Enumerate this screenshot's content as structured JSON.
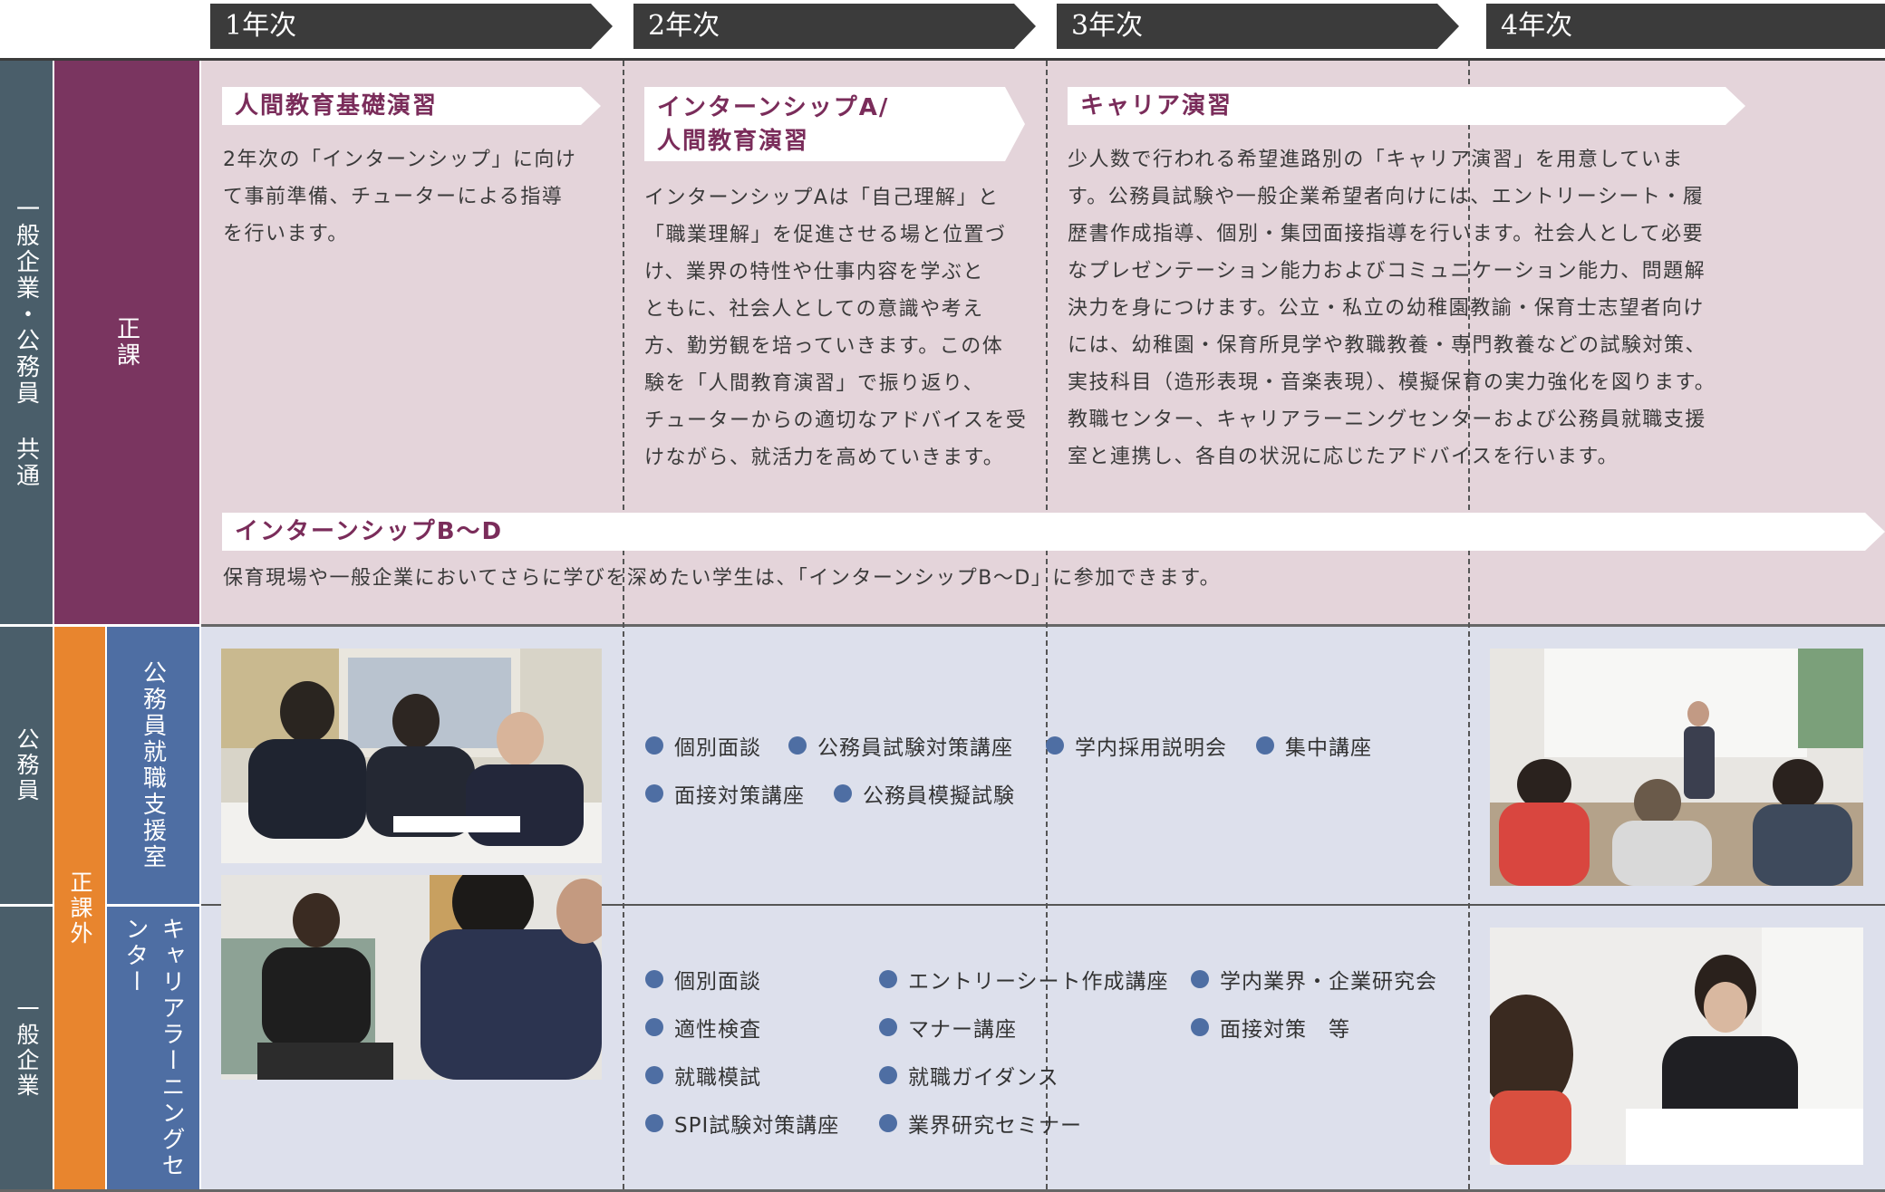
{
  "years": [
    "1年次",
    "2年次",
    "3年次",
    "4年次"
  ],
  "categories": {
    "common": "一般企業・公務員 共通",
    "regular": "正課",
    "civil_servant": "公務員",
    "extracurricular": "正課外",
    "civil_support_office": "公務員就職支援室",
    "general_company": "一般企業",
    "career_center": "キャリアラーニングセンター"
  },
  "regular": {
    "seminar1": {
      "title": "人間教育基礎演習",
      "text": "2年次の「インターンシップ」に向け\nて事前準備、チューターによる指導\nを行います。"
    },
    "seminar2": {
      "title_line1": "インターンシップA/",
      "title_line2": "人間教育演習",
      "text": "インターンシップAは「自己理解」と\n「職業理解」を促進させる場と位置づ\nけ、業界の特性や仕事内容を学ぶと\nともに、社会人としての意識や考え\n方、勤労観を培っていきます。この体\n験を「人間教育演習」で振り返り、\nチューターからの適切なアドバイスを受\nけながら、就活力を高めていきます。"
    },
    "career": {
      "title": "キャリア演習",
      "text": "少人数で行われる希望進路別の「キャリア演習」を用意していま\nす。公務員試験や一般企業希望者向けには、エントリーシート・履\n歴書作成指導、個別・集団面接指導を行います。社会人として必要\nなプレゼンテーション能力およびコミュニケーション能力、問題解\n決力を身につけます。公立・私立の幼稚園教諭・保育士志望者向け\nには、幼稚園・保育所見学や教職教養・専門教養などの試験対策、\n実技科目（造形表現・音楽表現）、模擬保育の実力強化を図ります。\n教職センター、キャリアラーニングセンターおよび公務員就職支援\n室と連携し、各自の状況に応じたアドバイスを行います。"
    },
    "internship_bd": {
      "title": "インターンシップB〜D",
      "text": "保育現場や一般企業においてさらに学びを深めたい学生は、「インターンシップB〜D」に参加できます。"
    }
  },
  "civil_items": [
    "個別面談",
    "公務員試験対策講座",
    "学内採用説明会",
    "集中講座",
    "面接対策講座",
    "公務員模擬試験"
  ],
  "company_items": [
    "個別面談",
    "適性検査",
    "就職模試",
    "SPI試験対策講座",
    "エントリーシート作成講座",
    "マナー講座",
    "就職ガイダンス",
    "業界研究セミナー",
    "学内業界・企業研究会",
    "面接対策　等"
  ],
  "colors": {
    "header": "#3b3b3b",
    "common_band": "#4a5e6a",
    "regular_band": "#7a3560",
    "extracurricular_band": "#e8852e",
    "office_band": "#4e6ea3",
    "pink_panel": "#e4d4da",
    "blue_panel": "#dde0ec",
    "title_text": "#7a2c5a",
    "bullet": "#4e6ea3"
  }
}
